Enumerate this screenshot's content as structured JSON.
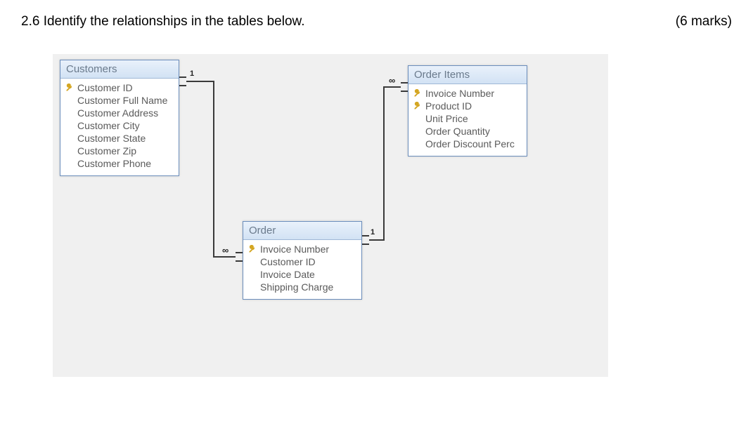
{
  "header": {
    "question_label": "2.6 Identify the relationships in the tables below.",
    "marks_label": "(6 marks)"
  },
  "tables": {
    "customers": {
      "title": "Customers",
      "fields": [
        {
          "label": "Customer ID",
          "key": true
        },
        {
          "label": "Customer Full Name",
          "key": false
        },
        {
          "label": "Customer Address",
          "key": false
        },
        {
          "label": "Customer City",
          "key": false
        },
        {
          "label": "Customer State",
          "key": false
        },
        {
          "label": "Customer Zip",
          "key": false
        },
        {
          "label": "Customer Phone",
          "key": false
        }
      ]
    },
    "order_items": {
      "title": "Order Items",
      "fields": [
        {
          "label": "Invoice Number",
          "key": true
        },
        {
          "label": "Product ID",
          "key": true
        },
        {
          "label": "Unit Price",
          "key": false
        },
        {
          "label": "Order Quantity",
          "key": false
        },
        {
          "label": "Order Discount Perc",
          "key": false
        }
      ]
    },
    "order": {
      "title": "Order",
      "fields": [
        {
          "label": "Invoice Number",
          "key": true
        },
        {
          "label": "Customer ID",
          "key": false
        },
        {
          "label": "Invoice Date",
          "key": false
        },
        {
          "label": "Shipping Charge",
          "key": false
        }
      ]
    }
  },
  "relationships": {
    "cust_order_one": "1",
    "cust_order_many": "∞",
    "order_items_one": "1",
    "order_items_many": "∞"
  }
}
